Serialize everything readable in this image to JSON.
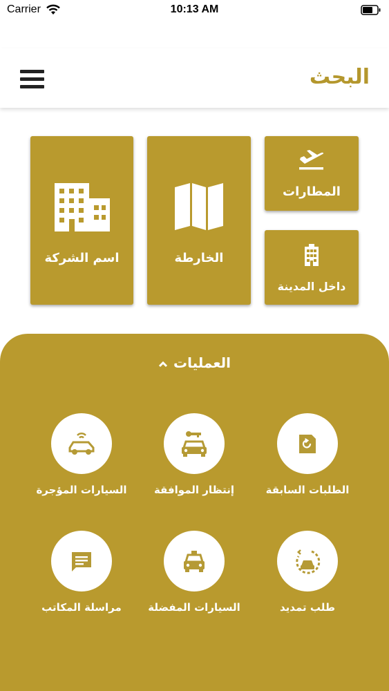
{
  "status_bar": {
    "carrier": "Carrier",
    "time": "10:13 AM"
  },
  "header": {
    "title": "البحث",
    "menu_icon": "hamburger-menu-icon"
  },
  "tiles": {
    "airports": {
      "label": "المطارات",
      "icon": "airplane-departure-icon"
    },
    "in_city": {
      "label": "داخل المدينة",
      "icon": "city-building-icon"
    },
    "map": {
      "label": "الخارطة",
      "icon": "folded-map-icon"
    },
    "company_name": {
      "label": "اسم الشركة",
      "icon": "office-building-icon"
    }
  },
  "operations": {
    "title": "العمليات",
    "items": [
      {
        "label": "الطلبات السابقة",
        "icon": "history-document-icon"
      },
      {
        "label": "إنتظار الموافقة",
        "icon": "car-key-icon"
      },
      {
        "label": "السيارات المؤجرة",
        "icon": "connected-car-icon"
      },
      {
        "label": "طلب تمديد",
        "icon": "extend-rental-car-icon"
      },
      {
        "label": "السيارات المفضلة",
        "icon": "taxi-car-icon"
      },
      {
        "label": "مراسلة المكاتب",
        "icon": "chat-message-icon"
      }
    ]
  },
  "colors": {
    "accent": "#b99a2e",
    "title": "#b4972d",
    "icon": "#b59a35"
  }
}
